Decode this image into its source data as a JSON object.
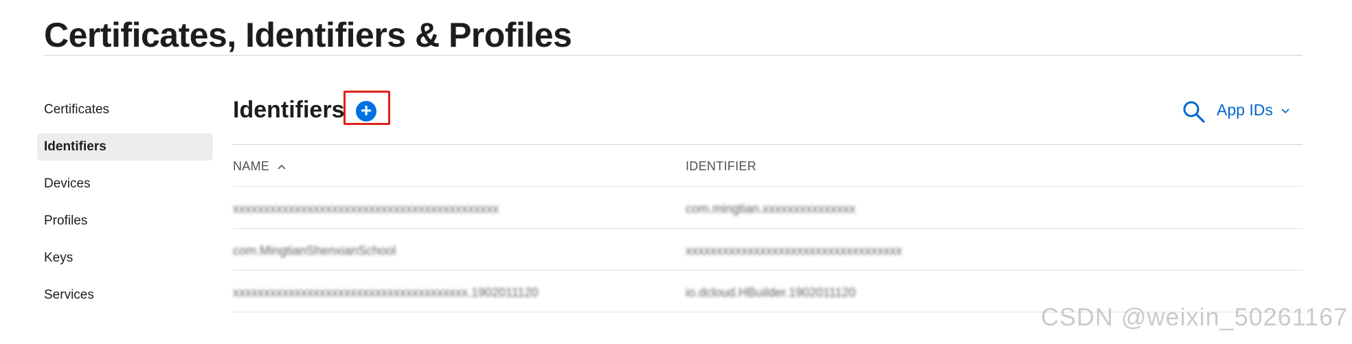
{
  "page": {
    "title": "Certificates, Identifiers & Profiles"
  },
  "sidebar": {
    "items": [
      {
        "label": "Certificates",
        "active": false
      },
      {
        "label": "Identifiers",
        "active": true
      },
      {
        "label": "Devices",
        "active": false
      },
      {
        "label": "Profiles",
        "active": false
      },
      {
        "label": "Keys",
        "active": false
      },
      {
        "label": "Services",
        "active": false
      }
    ]
  },
  "main": {
    "section_title": "Identifiers",
    "add_button_label": "+",
    "filter_label": "App IDs",
    "table": {
      "columns": [
        "NAME",
        "IDENTIFIER"
      ],
      "rows": [
        {
          "name": "xxxxxxxxxxxxxxxxxxxxxxxxxxxxxxxxxxxxxxxxxxx",
          "identifier": "com.mingtian.xxxxxxxxxxxxxxx"
        },
        {
          "name": "com.MingtianShenxianSchool",
          "identifier": "xxxxxxxxxxxxxxxxxxxxxxxxxxxxxxxxxxx"
        },
        {
          "name": "xxxxxxxxxxxxxxxxxxxxxxxxxxxxxxxxxxxxxx.1902011120",
          "identifier": "io.dcloud.HBuilder.1902011120"
        }
      ]
    }
  },
  "watermark": "CSDN @weixin_50261167",
  "colors": {
    "accent": "#0071e3",
    "link": "#0066cc",
    "highlight": "#e0201a",
    "sidebar_active_bg": "#ededed"
  }
}
